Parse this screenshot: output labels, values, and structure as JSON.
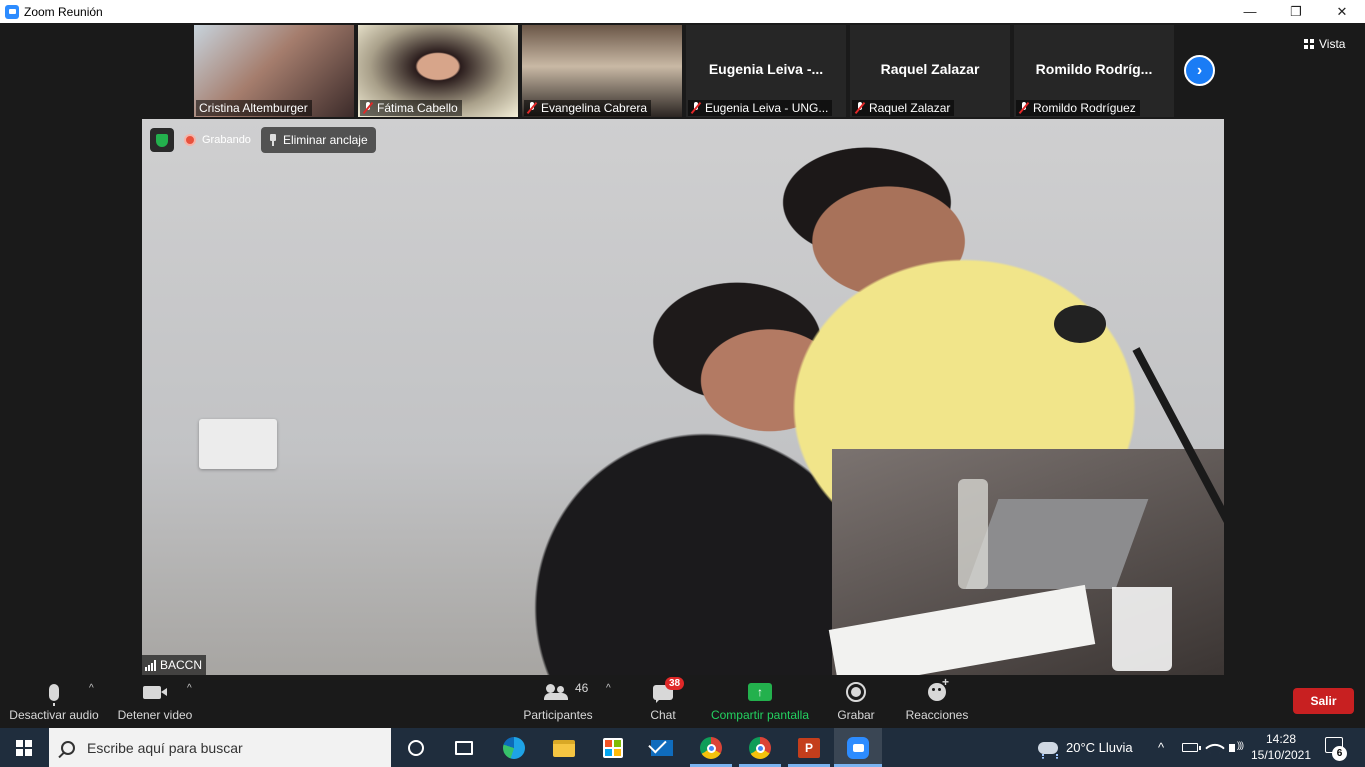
{
  "window": {
    "title": "Zoom Reunión",
    "controls": [
      "—",
      "❐",
      "✕"
    ]
  },
  "view_button": {
    "label": "Vista"
  },
  "gallery": [
    {
      "display": "video",
      "name": "Cristina Altemburger",
      "muted": false
    },
    {
      "display": "video",
      "name": "Fátima Cabello",
      "muted": true
    },
    {
      "display": "video",
      "name": "Evangelina Cabrera",
      "muted": true
    },
    {
      "display": "name",
      "big_name": "Eugenia  Leiva  -...",
      "name": "Eugenia Leiva - UNG...",
      "muted": true
    },
    {
      "display": "name",
      "big_name": "Raquel Zalazar",
      "name": "Raquel Zalazar",
      "muted": true
    },
    {
      "display": "name",
      "big_name": "Romildo  Rodríg...",
      "name": "Romildo Rodríguez",
      "muted": true
    }
  ],
  "next_page_arrow": "›",
  "main_video": {
    "recording_label": "Grabando",
    "unpin_label": "Eliminar anclaje",
    "speaker_name": "BACCN"
  },
  "toolbar": {
    "audio_label": "Desactivar audio",
    "video_label": "Detener video",
    "participants_label": "Participantes",
    "participants_count": "46",
    "chat_label": "Chat",
    "chat_badge": "38",
    "share_label": "Compartir pantalla",
    "share_icon_glyph": "↑",
    "record_label": "Grabar",
    "reactions_label": "Reacciones",
    "leave_label": "Salir",
    "caret": "^"
  },
  "taskbar": {
    "search_placeholder": "Escribe aquí para buscar",
    "ppt_glyph": "P",
    "weather": "20°C  Lluvia",
    "tray_caret": "^",
    "time": "14:28",
    "date": "15/10/2021",
    "notifications_count": "6"
  },
  "colors": {
    "accent_blue": "#1a7cf5",
    "leave_red": "#c82021",
    "share_green": "#23b14d",
    "taskbar": "#1f2d3d"
  }
}
